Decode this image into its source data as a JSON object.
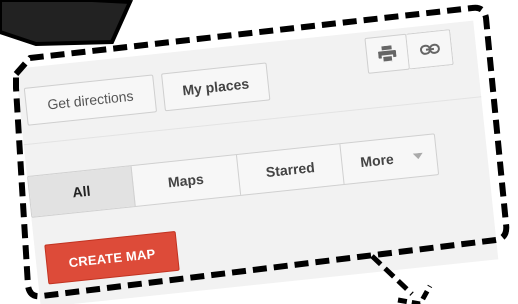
{
  "toolbar": {
    "get_directions_label": "Get directions",
    "my_places_label": "My places",
    "print_icon": "printer-icon",
    "link_icon": "link-icon"
  },
  "filter_tabs": [
    {
      "label": "All",
      "selected": true
    },
    {
      "label": "Maps",
      "selected": false
    },
    {
      "label": "Starred",
      "selected": false
    },
    {
      "label": "More",
      "selected": false,
      "has_dropdown": true
    }
  ],
  "create_map": {
    "label": "CREATE MAP",
    "color": "#dd4b39"
  },
  "colors": {
    "panel_background": "#f2f2f2",
    "button_background": "#f7f7f7",
    "selected_tab_background": "#e2e2e2",
    "callout_fill": "#222222",
    "dashed_outline": "#000000"
  }
}
